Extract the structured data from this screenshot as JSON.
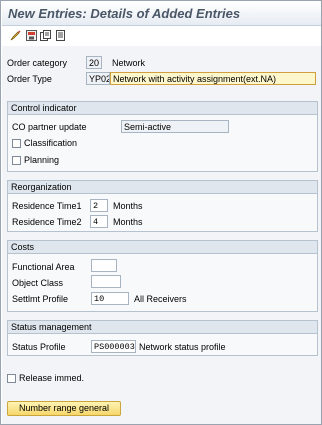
{
  "window": {
    "title": "New Entries: Details of Added Entries"
  },
  "toolbar": {
    "icons": [
      "edit-icon",
      "save-variant-icon",
      "copy-icon",
      "print-icon"
    ]
  },
  "header": {
    "order_category_label": "Order category",
    "order_category_value": "20",
    "order_category_text": "Network",
    "order_type_label": "Order Type",
    "order_type_value": "YP02",
    "order_type_text": "Network with activity assignment(ext.NA)"
  },
  "control_indicator": {
    "title": "Control indicator",
    "co_partner_label": "CO partner update",
    "co_partner_value": "Semi-active",
    "classification_label": "Classification",
    "planning_label": "Planning"
  },
  "reorganization": {
    "title": "Reorganization",
    "res1_label": "Residence Time1",
    "res1_value": "2",
    "res1_unit": "Months",
    "res2_label": "Residence Time2",
    "res2_value": "4",
    "res2_unit": "Months"
  },
  "costs": {
    "title": "Costs",
    "functional_area_label": "Functional Area",
    "functional_area_value": "",
    "object_class_label": "Object Class",
    "object_class_value": "",
    "settlmt_label": "Settlmt Profile",
    "settlmt_value": "10",
    "settlmt_text": "All Receivers"
  },
  "status_management": {
    "title": "Status management",
    "status_profile_label": "Status Profile",
    "status_profile_value": "PS000003",
    "status_profile_text": "Network status profile"
  },
  "release": {
    "label": "Release immed."
  },
  "buttons": {
    "number_range": "Number range general"
  }
}
